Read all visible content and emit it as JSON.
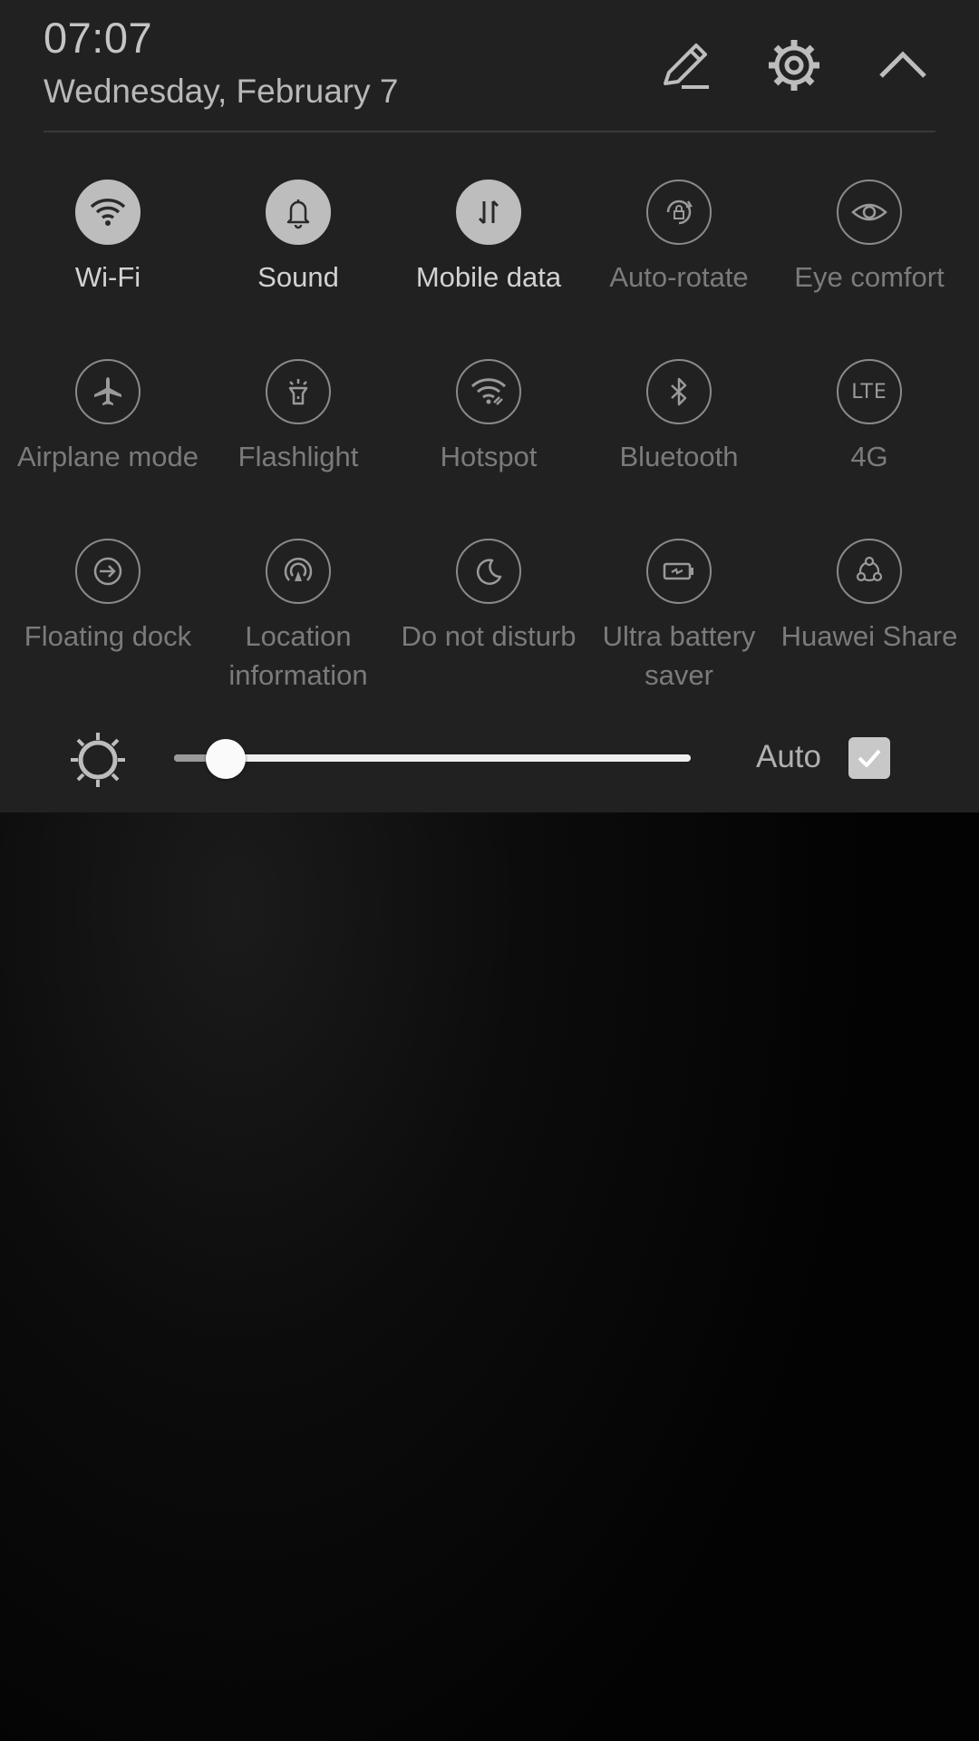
{
  "header": {
    "time": "07:07",
    "date": "Wednesday, February 7",
    "edit_icon": "pencil-icon",
    "settings_icon": "gear-icon",
    "collapse_icon": "chevron-up-icon"
  },
  "tiles": [
    {
      "label": "Wi-Fi",
      "icon": "wifi-icon",
      "active": true
    },
    {
      "label": "Sound",
      "icon": "bell-icon",
      "active": true
    },
    {
      "label": "Mobile data",
      "icon": "data-arrows-icon",
      "active": true
    },
    {
      "label": "Auto-rotate",
      "icon": "rotate-lock-icon",
      "active": false
    },
    {
      "label": "Eye comfort",
      "icon": "eye-icon",
      "active": false
    },
    {
      "label": "Airplane mode",
      "icon": "airplane-icon",
      "active": false
    },
    {
      "label": "Flashlight",
      "icon": "flashlight-icon",
      "active": false
    },
    {
      "label": "Hotspot",
      "icon": "hotspot-icon",
      "active": false
    },
    {
      "label": "Bluetooth",
      "icon": "bluetooth-icon",
      "active": false
    },
    {
      "label": "4G",
      "icon": "lte-icon",
      "icon_text": "LTE",
      "active": false
    },
    {
      "label": "Floating dock",
      "icon": "floating-dock-icon",
      "active": false
    },
    {
      "label": "Location\ninformation",
      "icon": "location-icon",
      "active": false
    },
    {
      "label": "Do not disturb",
      "icon": "moon-icon",
      "active": false
    },
    {
      "label": "Ultra battery\nsaver",
      "icon": "battery-saver-icon",
      "active": false
    },
    {
      "label": "Huawei Share",
      "icon": "share-icon",
      "active": false
    }
  ],
  "brightness": {
    "icon": "sun-icon",
    "level_percent": 10,
    "auto_label": "Auto",
    "auto_checked": true
  },
  "colors": {
    "panel": "#212121",
    "active_tile": "#bdbdbd",
    "inactive_text": "#7b7b7b"
  }
}
